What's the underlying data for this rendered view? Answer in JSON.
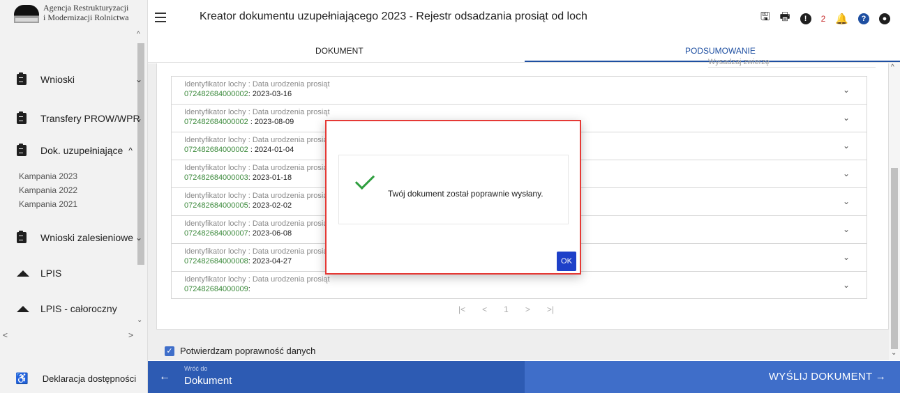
{
  "logo": {
    "line1": "Agencja Restrukturyzacji",
    "line2": "i Modernizacji Rolnictwa"
  },
  "sidebar": {
    "items": [
      {
        "label": "Wnioski",
        "chevron": "⌄"
      },
      {
        "label": "Transfery PROW/WPR",
        "chevron": "⌄"
      },
      {
        "label": "Dok. uzupełniające",
        "chevron": "^"
      },
      {
        "label": "Wnioski zalesieniowe",
        "chevron": "⌄"
      },
      {
        "label": "LPIS"
      },
      {
        "label": "LPIS - całoroczny"
      }
    ],
    "subitems": [
      "Kampania 2023",
      "Kampania 2022",
      "Kampania 2021"
    ],
    "accessibility": "Deklaracja dostępności"
  },
  "header": {
    "title": "Kreator dokumentu uzupełniającego 2023 - Rejestr odsadzania prosiąt od loch",
    "notifications_count": "2"
  },
  "tabs": [
    {
      "label": "DOKUMENT"
    },
    {
      "label": "PODSUMOWANIE"
    }
  ],
  "list": {
    "prev_hint": "Wysadzaj zwierzę",
    "label": "Identyfikator lochy : Data urodzenia prosiąt",
    "rows": [
      {
        "id": "072482684000002",
        "date": ": 2023-03-16"
      },
      {
        "id": "072482684000002",
        "date": " : 2023-08-09"
      },
      {
        "id": "072482684000002",
        "date": " : 2024-01-04"
      },
      {
        "id": "072482684000003",
        "date": ": 2023-01-18"
      },
      {
        "id": "072482684000005",
        "date": ": 2023-02-02"
      },
      {
        "id": "072482684000007",
        "date": ": 2023-06-08"
      },
      {
        "id": "072482684000008",
        "date": ": 2023-04-27"
      },
      {
        "id": "072482684000009",
        "date": ":"
      }
    ],
    "pager": {
      "first": "|<",
      "prev": "<",
      "page": "1",
      "next": ">",
      "last": ">|"
    }
  },
  "confirm": {
    "label": "Potwierdzam poprawność danych",
    "checked": true
  },
  "bottom": {
    "back_small": "Wróć do",
    "back_big": "Dokument",
    "send": "WYŚLIJ DOKUMENT"
  },
  "modal": {
    "message": "Twój dokument został poprawnie wysłany.",
    "ok": "OK"
  },
  "colors": {
    "primary": "#2d5bb3",
    "accent": "#3f6ec9",
    "success": "#2e9e3e",
    "id_green": "#3c8a3c",
    "modal_border": "#e53935"
  }
}
